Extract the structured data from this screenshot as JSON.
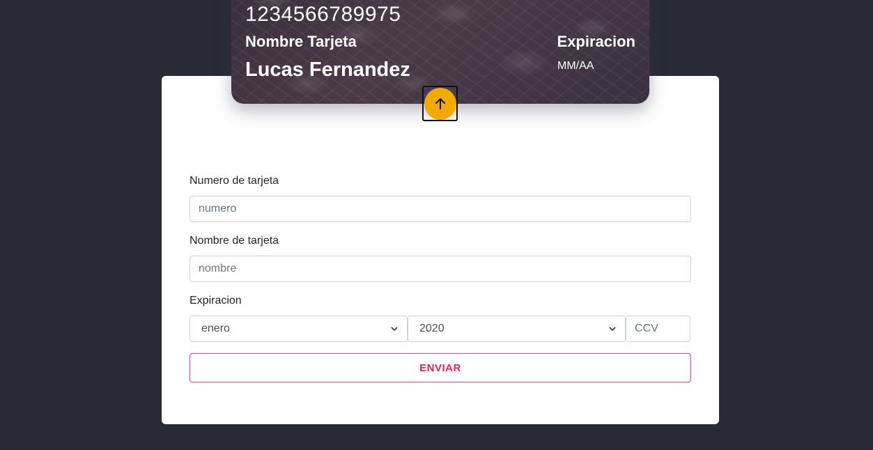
{
  "card": {
    "number": "1234566789975",
    "name_label": "Nombre Tarjeta",
    "name": "Lucas Fernandez",
    "expiration_label": "Expiracion",
    "expiration_value": "MM/AA"
  },
  "toggle": {
    "icon": "arrow-up-icon",
    "color": "#f2a900"
  },
  "form": {
    "card_number": {
      "label": "Numero de tarjeta",
      "placeholder": "numero",
      "value": ""
    },
    "card_name": {
      "label": "Nombre de tarjeta",
      "placeholder": "nombre",
      "value": ""
    },
    "expiration": {
      "label": "Expiracion",
      "month_selected": "enero",
      "year_selected": "2020"
    },
    "ccv": {
      "placeholder": "CCV",
      "value": ""
    },
    "submit_label": "ENVIAR"
  },
  "colors": {
    "background": "#282b33",
    "panel": "#ffffff",
    "accent_pink": "#e83e8c",
    "toggle_yellow": "#f2a900"
  }
}
